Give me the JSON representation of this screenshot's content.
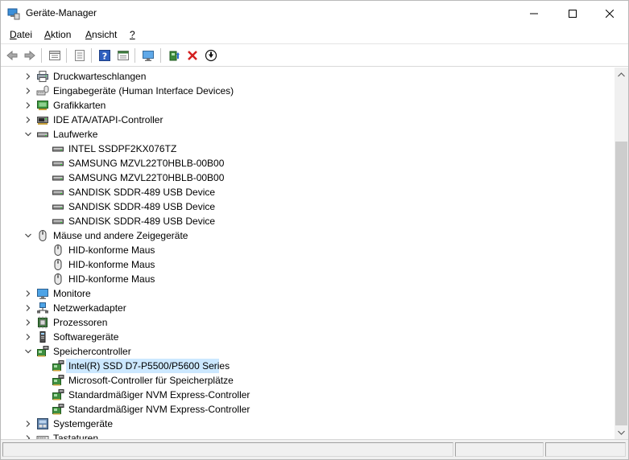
{
  "window": {
    "title": "Geräte-Manager"
  },
  "menu": [
    {
      "key": "D",
      "rest": "atei"
    },
    {
      "key": "A",
      "rest": "ktion"
    },
    {
      "key": "A",
      "rest": "nsicht"
    },
    {
      "key": "?",
      "rest": ""
    }
  ],
  "toolbar": {
    "buttons": [
      "back-icon",
      "forward-icon",
      "properties-icon",
      "scan-icon",
      "help-icon",
      "view-icon",
      "monitor-icon",
      "update-driver-icon",
      "uninstall-icon",
      "download-icon"
    ]
  },
  "tree": {
    "groups": [
      {
        "label": "Druckwarteschlangen",
        "icon": "printer-icon",
        "expanded": false
      },
      {
        "label": "Eingabegeräte (Human Interface Devices)",
        "icon": "hid-icon",
        "expanded": false
      },
      {
        "label": "Grafikkarten",
        "icon": "display-adapter-icon",
        "expanded": false
      },
      {
        "label": "IDE ATA/ATAPI-Controller",
        "icon": "ide-icon",
        "expanded": false
      },
      {
        "label": "Laufwerke",
        "icon": "drive-icon",
        "expanded": true,
        "children": [
          {
            "label": "INTEL SSDPF2KX076TZ",
            "icon": "drive-icon"
          },
          {
            "label": "SAMSUNG MZVL22T0HBLB-00B00",
            "icon": "drive-icon"
          },
          {
            "label": "SAMSUNG MZVL22T0HBLB-00B00",
            "icon": "drive-icon"
          },
          {
            "label": "SANDISK SDDR-489 USB Device",
            "icon": "drive-icon"
          },
          {
            "label": "SANDISK SDDR-489 USB Device",
            "icon": "drive-icon"
          },
          {
            "label": "SANDISK SDDR-489 USB Device",
            "icon": "drive-icon"
          }
        ]
      },
      {
        "label": "Mäuse und andere Zeigegeräte",
        "icon": "mouse-icon",
        "expanded": true,
        "children": [
          {
            "label": "HID-konforme Maus",
            "icon": "mouse-icon"
          },
          {
            "label": "HID-konforme Maus",
            "icon": "mouse-icon"
          },
          {
            "label": "HID-konforme Maus",
            "icon": "mouse-icon"
          }
        ]
      },
      {
        "label": "Monitore",
        "icon": "monitor-icon",
        "expanded": false
      },
      {
        "label": "Netzwerkadapter",
        "icon": "network-icon",
        "expanded": false
      },
      {
        "label": "Prozessoren",
        "icon": "cpu-icon",
        "expanded": false
      },
      {
        "label": "Softwaregeräte",
        "icon": "software-device-icon",
        "expanded": false
      },
      {
        "label": "Speichercontroller",
        "icon": "storage-controller-icon",
        "expanded": true,
        "children": [
          {
            "label": "Intel(R) SSD D7-P5500/P5600 Series",
            "icon": "storage-controller-icon",
            "selected": true
          },
          {
            "label": "Microsoft-Controller für Speicherplätze",
            "icon": "storage-controller-icon"
          },
          {
            "label": "Standardmäßiger NVM Express-Controller",
            "icon": "storage-controller-icon"
          },
          {
            "label": "Standardmäßiger NVM Express-Controller",
            "icon": "storage-controller-icon"
          }
        ]
      },
      {
        "label": "Systemgeräte",
        "icon": "system-device-icon",
        "expanded": false
      },
      {
        "label": "Tastaturen",
        "icon": "keyboard-icon",
        "expanded": false
      }
    ]
  },
  "scrollbar": {
    "position": 0.2
  }
}
